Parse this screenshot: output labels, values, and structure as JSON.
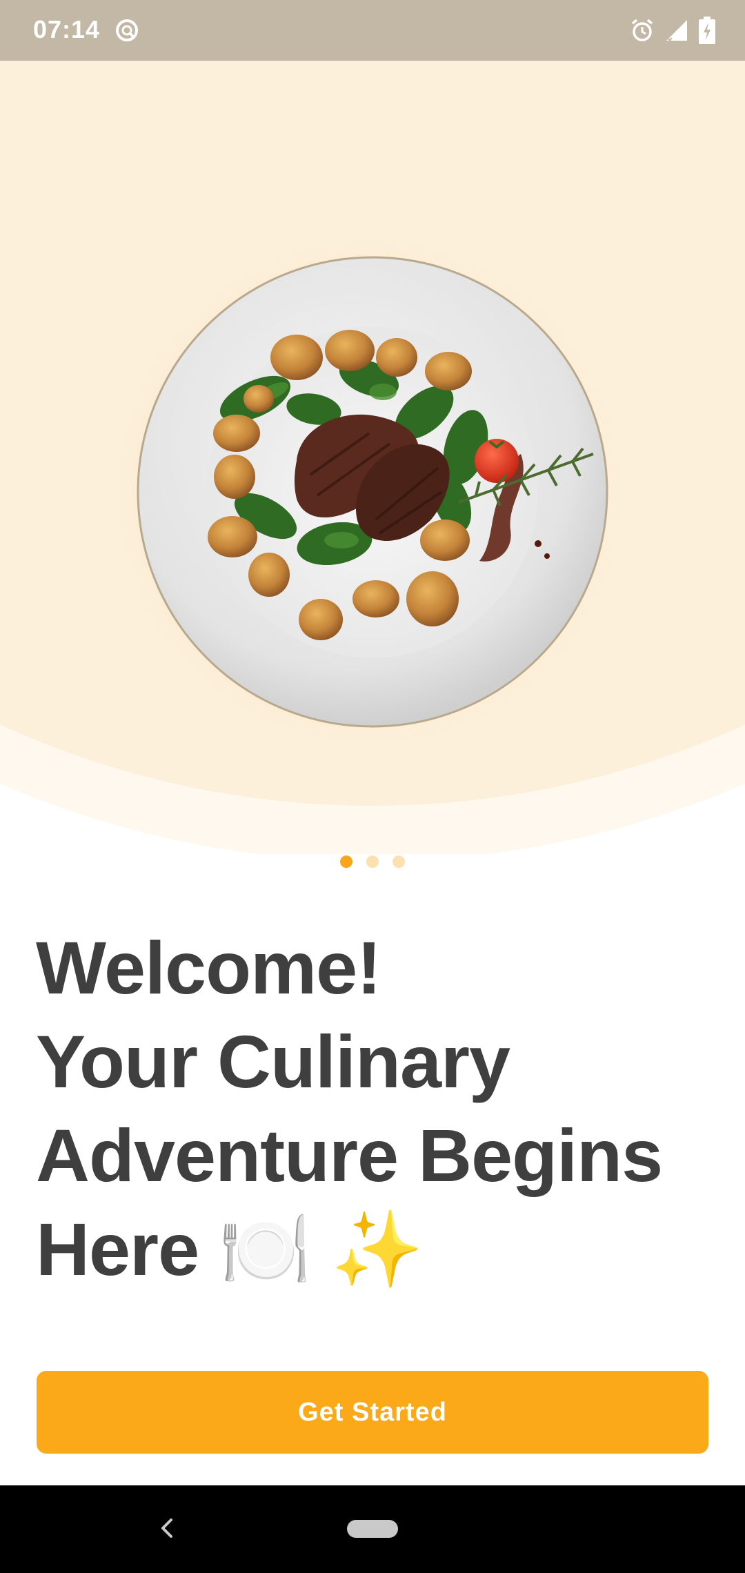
{
  "status_bar": {
    "time": "07:14",
    "icons": [
      "app-notification-icon",
      "alarm-icon",
      "signal-icon",
      "battery-charging-icon"
    ]
  },
  "hero": {
    "image": "plated steak with roasted potatoes, spinach, cherry tomato and rosemary"
  },
  "carousel": {
    "page_count": 3,
    "active_index": 0,
    "active_color": "#f9a61a",
    "inactive_color": "#fde0b0"
  },
  "headline": {
    "line1": "Welcome!",
    "line2": "Your Culinary",
    "line3": "Adventure Begins",
    "line4": "Here 🍽️ ✨"
  },
  "cta": {
    "label": "Get Started",
    "color": "#fba919"
  },
  "nav_bar": {
    "icons": [
      "back-icon",
      "home-pill-icon"
    ]
  }
}
